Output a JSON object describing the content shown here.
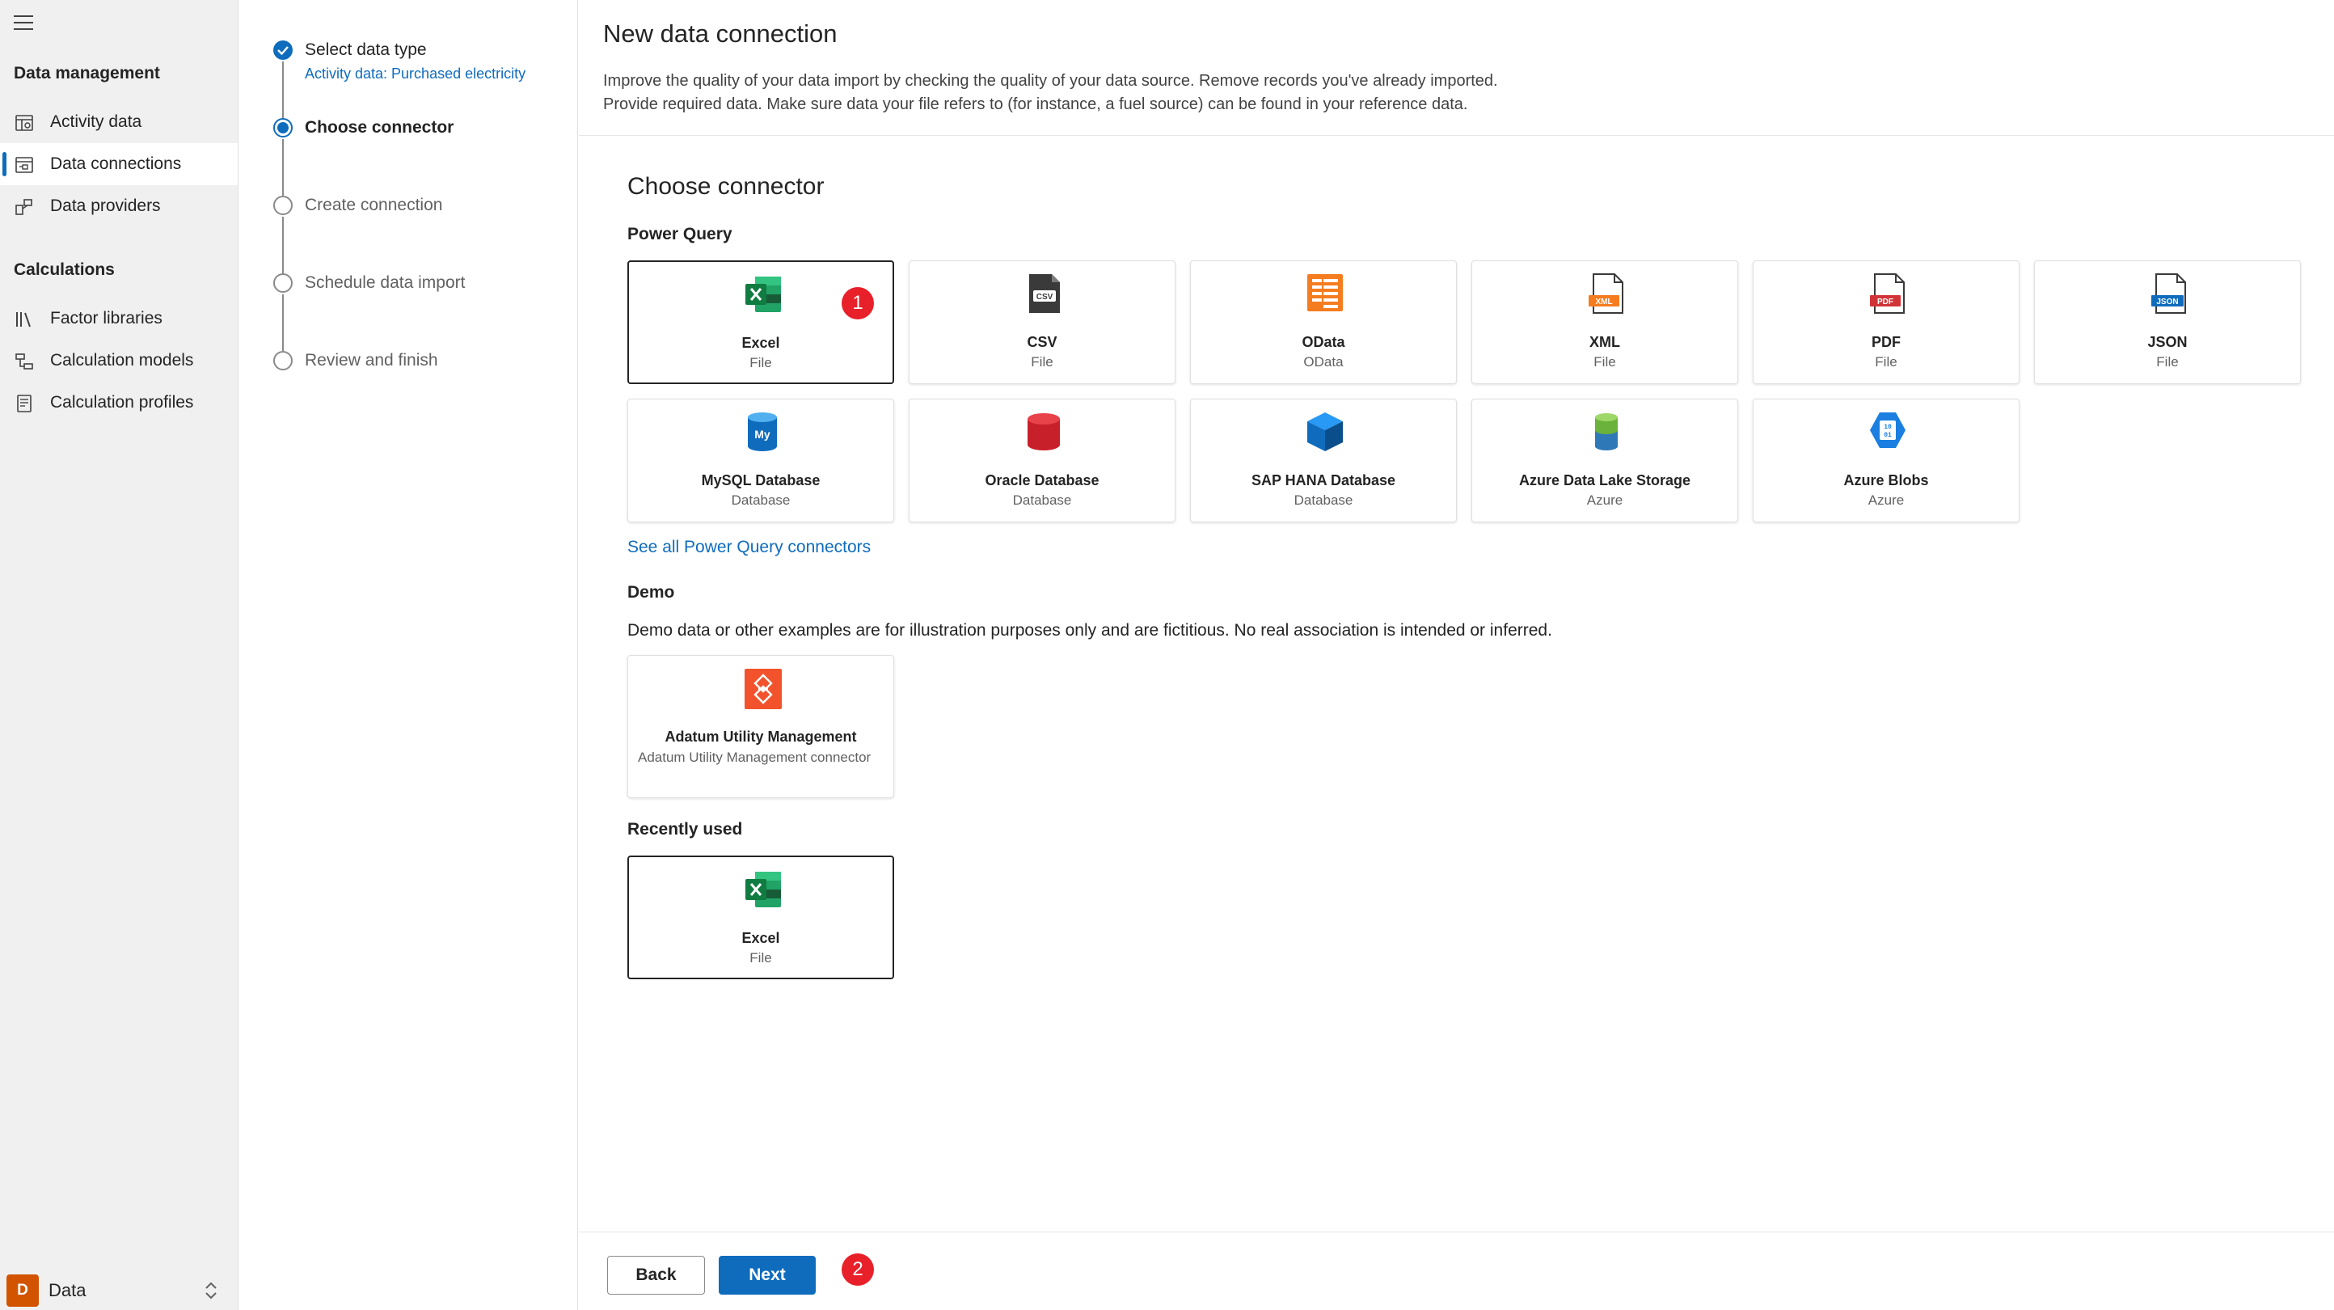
{
  "nav": {
    "sections": [
      {
        "title": "Data management",
        "items": [
          {
            "label": "Activity data",
            "icon": "activity-data-icon",
            "active": false
          },
          {
            "label": "Data connections",
            "icon": "data-connections-icon",
            "active": true
          },
          {
            "label": "Data providers",
            "icon": "data-providers-icon",
            "active": false
          }
        ]
      },
      {
        "title": "Calculations",
        "items": [
          {
            "label": "Factor libraries",
            "icon": "factor-libraries-icon",
            "active": false
          },
          {
            "label": "Calculation models",
            "icon": "calculation-models-icon",
            "active": false
          },
          {
            "label": "Calculation profiles",
            "icon": "calculation-profiles-icon",
            "active": false
          }
        ]
      }
    ],
    "area": {
      "badge": "D",
      "label": "Data"
    }
  },
  "stepper": {
    "steps": [
      {
        "label": "Select data type",
        "sublabel": "Activity data: Purchased electricity",
        "state": "done"
      },
      {
        "label": "Choose connector",
        "state": "current"
      },
      {
        "label": "Create connection",
        "state": "todo"
      },
      {
        "label": "Schedule data import",
        "state": "todo"
      },
      {
        "label": "Review and finish",
        "state": "todo"
      }
    ]
  },
  "header": {
    "title": "New data connection",
    "description_line1": "Improve the quality of your data import by checking the quality of your data source. Remove records you've already imported.",
    "description_line2": "Provide required data. Make sure data your file refers to (for instance, a fuel source) can be found in your reference data."
  },
  "main": {
    "title": "Choose connector",
    "power_query": {
      "title": "Power Query",
      "connectors": [
        {
          "title": "Excel",
          "sub": "File",
          "icon": "excel-icon",
          "selected": true
        },
        {
          "title": "CSV",
          "sub": "File",
          "icon": "csv-icon"
        },
        {
          "title": "OData",
          "sub": "OData",
          "icon": "odata-icon"
        },
        {
          "title": "XML",
          "sub": "File",
          "icon": "xml-icon"
        },
        {
          "title": "PDF",
          "sub": "File",
          "icon": "pdf-icon"
        },
        {
          "title": "JSON",
          "sub": "File",
          "icon": "json-icon"
        },
        {
          "title": "MySQL Database",
          "sub": "Database",
          "icon": "mysql-icon"
        },
        {
          "title": "Oracle Database",
          "sub": "Database",
          "icon": "oracle-icon"
        },
        {
          "title": "SAP HANA Database",
          "sub": "Database",
          "icon": "sap-hana-icon"
        },
        {
          "title": "Azure Data Lake Storage",
          "sub": "Azure",
          "icon": "azure-data-lake-icon"
        },
        {
          "title": "Azure Blobs",
          "sub": "Azure",
          "icon": "azure-blobs-icon"
        }
      ],
      "see_all": "See all Power Query connectors"
    },
    "demo": {
      "title": "Demo",
      "note": "Demo data or other examples are for illustration purposes only and are fictitious. No real association is intended or inferred.",
      "connector": {
        "title": "Adatum Utility Management",
        "sub": "Adatum Utility Management connector",
        "icon": "adatum-icon"
      }
    },
    "recent": {
      "title": "Recently used",
      "connector": {
        "title": "Excel",
        "sub": "File",
        "icon": "excel-icon"
      }
    }
  },
  "callouts": [
    "1",
    "2"
  ],
  "footer": {
    "back_label": "Back",
    "next_label": "Next"
  },
  "colors": {
    "accent": "#0f6cbd",
    "callout": "#e8202a",
    "excel": "#107c41",
    "area_badge": "#d35400"
  }
}
